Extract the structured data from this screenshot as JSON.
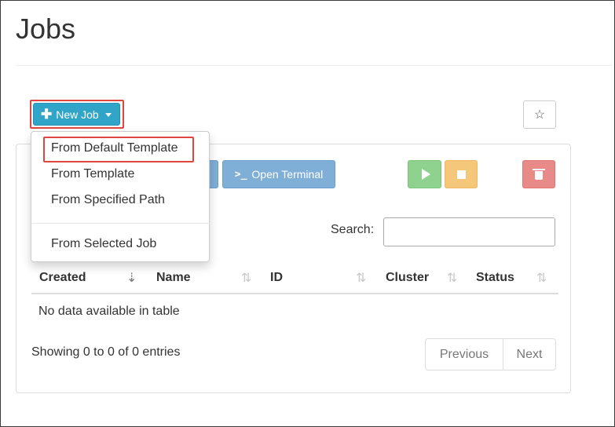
{
  "page": {
    "title": "Jobs"
  },
  "toolbar": {
    "new_job_label": "New Job",
    "open_terminal_label": "Open Terminal",
    "star_glyph": "☆"
  },
  "dropdown": {
    "items": [
      {
        "label": "From Default Template",
        "highlighted": true
      },
      {
        "label": "From Template"
      },
      {
        "label": "From Specified Path"
      },
      {
        "label": "From Selected Job"
      }
    ]
  },
  "search": {
    "label": "Search:",
    "value": "",
    "placeholder": ""
  },
  "table": {
    "columns": [
      {
        "label": "Created",
        "sort": "descending"
      },
      {
        "label": "Name",
        "sort": "none"
      },
      {
        "label": "ID",
        "sort": "none"
      },
      {
        "label": "Cluster",
        "sort": "none"
      },
      {
        "label": "Status",
        "sort": "none"
      }
    ],
    "empty_message": "No data available in table",
    "info": "Showing 0 to 0 of 0 entries"
  },
  "pagination": {
    "previous_label": "Previous",
    "next_label": "Next"
  },
  "colors": {
    "primary": "#31a5c8",
    "highlight": "#e0463f",
    "success": "#8fd18f",
    "warning": "#f5c77b",
    "danger": "#e88a88",
    "terminal": "#7faed6"
  },
  "icons": [
    "plus-icon",
    "caret-down-icon",
    "star-icon",
    "terminal-icon",
    "play-icon",
    "stop-icon",
    "trash-icon",
    "sort-icon"
  ]
}
